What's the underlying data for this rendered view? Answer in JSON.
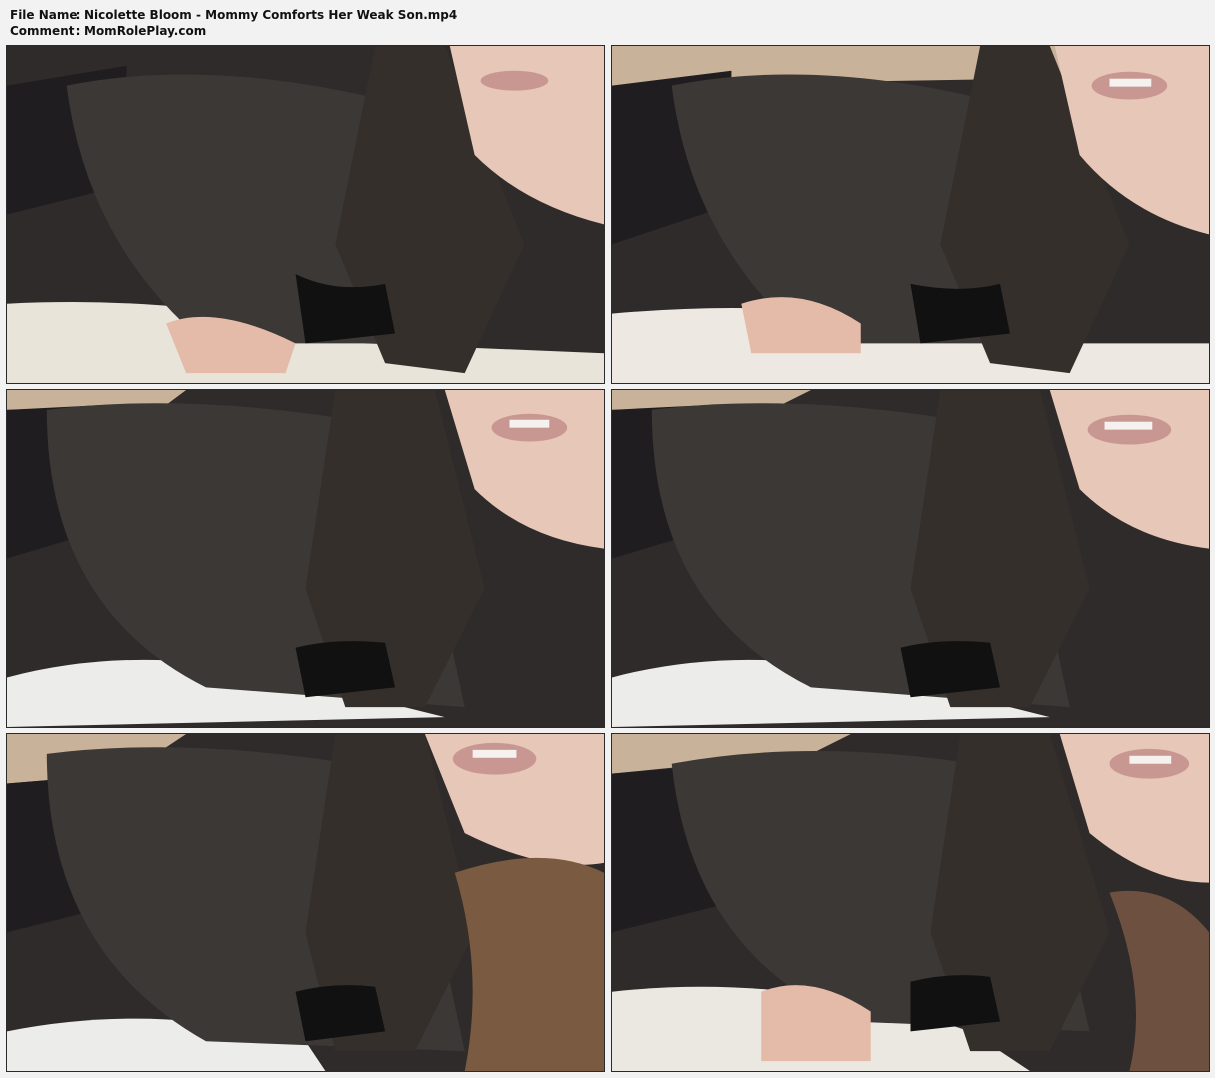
{
  "header": {
    "file_name_label": "File Name",
    "file_name_value": "Nicolette Bloom - Mommy Comforts Her Weak Son.mp4",
    "comment_label": "Comment",
    "comment_value": "MomRolePlay.com",
    "separator": ":"
  },
  "thumbnails": [
    {
      "index": 1,
      "content": "video-frame"
    },
    {
      "index": 2,
      "content": "video-frame"
    },
    {
      "index": 3,
      "content": "video-frame"
    },
    {
      "index": 4,
      "content": "video-frame"
    },
    {
      "index": 5,
      "content": "video-frame"
    },
    {
      "index": 6,
      "content": "video-frame"
    }
  ]
}
